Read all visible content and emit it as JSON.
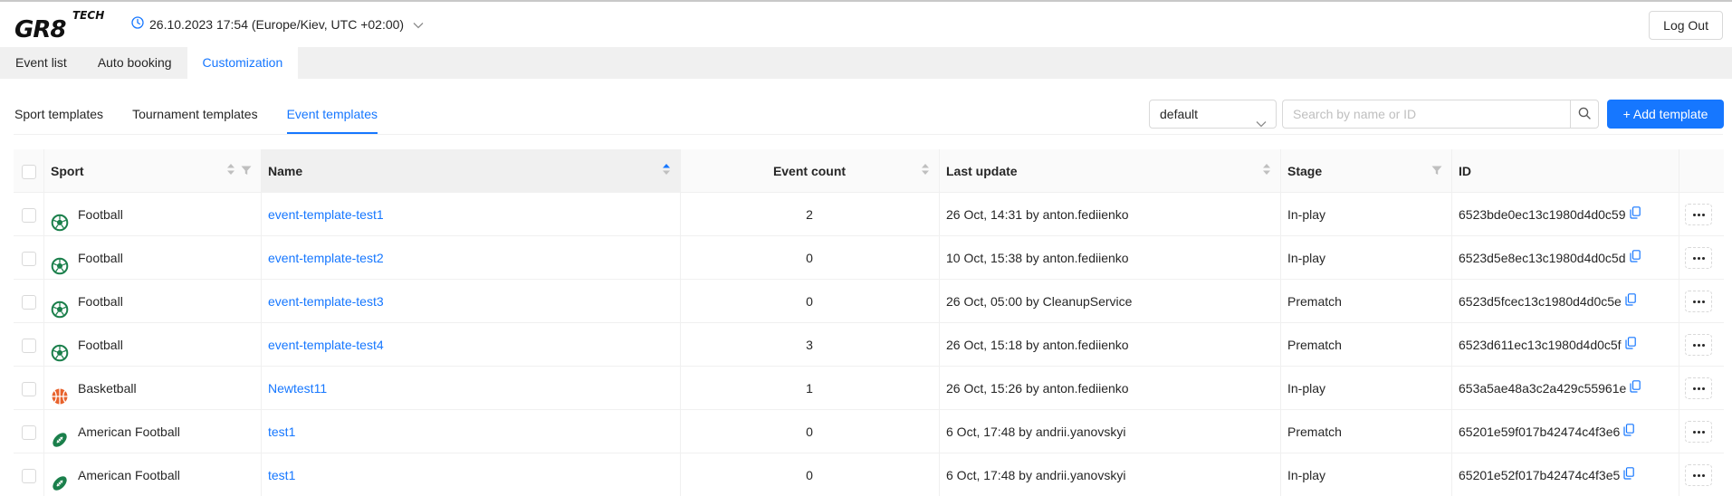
{
  "header": {
    "logo_main": "GR8",
    "logo_tag": "TECH",
    "datetime": "26.10.2023 17:54 (Europe/Kiev, UTC +02:00)",
    "logout_label": "Log Out"
  },
  "main_tabs": [
    {
      "label": "Event list",
      "active": false
    },
    {
      "label": "Auto booking",
      "active": false
    },
    {
      "label": "Customization",
      "active": true
    }
  ],
  "sub_tabs": [
    {
      "label": "Sport templates",
      "active": false
    },
    {
      "label": "Tournament templates",
      "active": false
    },
    {
      "label": "Event templates",
      "active": true
    }
  ],
  "toolbar": {
    "select_value": "default",
    "search_placeholder": "Search by name or ID",
    "add_label": "+ Add template"
  },
  "table": {
    "columns": {
      "sport": "Sport",
      "name": "Name",
      "event_count": "Event count",
      "last_update": "Last update",
      "stage": "Stage",
      "id": "ID"
    },
    "rows": [
      {
        "sport": "Football",
        "sport_icon": "football-icon",
        "name": "event-template-test1",
        "event_count": "2",
        "last_update": "26 Oct, 14:31 by anton.fediienko",
        "stage": "In-play",
        "id": "6523bde0ec13c1980d4d0c59"
      },
      {
        "sport": "Football",
        "sport_icon": "football-icon",
        "name": "event-template-test2",
        "event_count": "0",
        "last_update": "10 Oct, 15:38 by anton.fediienko",
        "stage": "In-play",
        "id": "6523d5e8ec13c1980d4d0c5d"
      },
      {
        "sport": "Football",
        "sport_icon": "football-icon",
        "name": "event-template-test3",
        "event_count": "0",
        "last_update": "26 Oct, 05:00 by CleanupService",
        "stage": "Prematch",
        "id": "6523d5fcec13c1980d4d0c5e"
      },
      {
        "sport": "Football",
        "sport_icon": "football-icon",
        "name": "event-template-test4",
        "event_count": "3",
        "last_update": "26 Oct, 15:18 by anton.fediienko",
        "stage": "Prematch",
        "id": "6523d611ec13c1980d4d0c5f"
      },
      {
        "sport": "Basketball",
        "sport_icon": "basketball-icon",
        "name": "Newtest11",
        "event_count": "1",
        "last_update": "26 Oct, 15:26 by anton.fediienko",
        "stage": "In-play",
        "id": "653a5ae48a3c2a429c55961e"
      },
      {
        "sport": "American Football",
        "sport_icon": "american-football-icon",
        "name": "test1",
        "event_count": "0",
        "last_update": "6 Oct, 17:48 by andrii.yanovskyi",
        "stage": "Prematch",
        "id": "65201e59f017b42474c4f3e6"
      },
      {
        "sport": "American Football",
        "sport_icon": "american-football-icon",
        "name": "test1",
        "event_count": "0",
        "last_update": "6 Oct, 17:48 by andrii.yanovskyi",
        "stage": "In-play",
        "id": "65201e52f017b42474c4f3e5"
      }
    ]
  },
  "colors": {
    "accent": "#1677ff",
    "football": "#1a7f4b",
    "basketball": "#e8622c"
  }
}
